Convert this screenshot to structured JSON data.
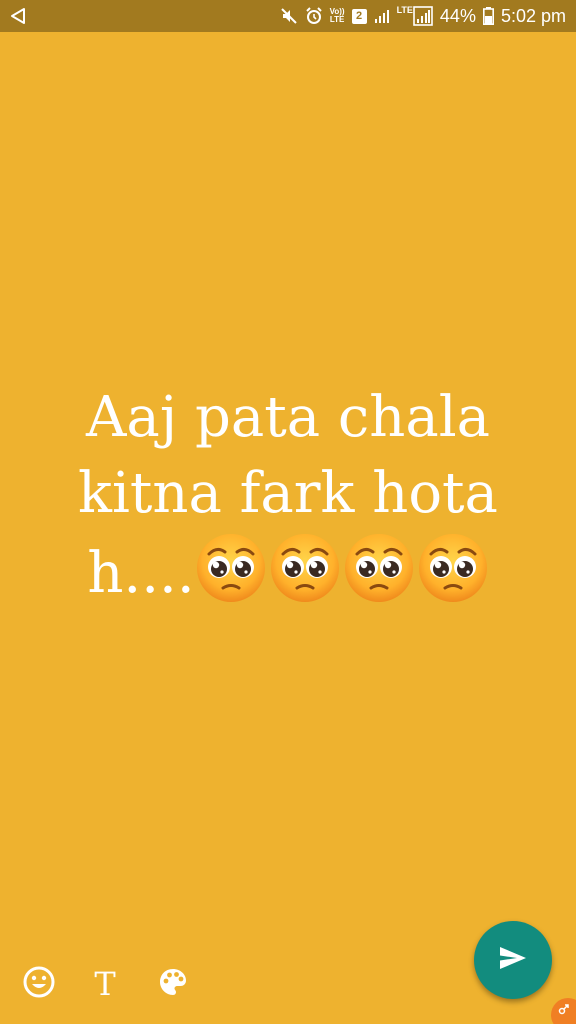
{
  "status_bar": {
    "battery_percent": "44%",
    "time": "5:02 pm",
    "volte_label": "Vo))",
    "lte_small_label": "LTE",
    "sim_number": "2",
    "lte_label": "LTE",
    "icons": [
      "back-icon",
      "mute-icon",
      "alarm-icon",
      "volte-icon",
      "sim-icon",
      "signal-icon",
      "lte-signal-icon",
      "battery-icon"
    ]
  },
  "status_text": {
    "lines": [
      "Aaj pata chala",
      "kitna fark hota",
      "h...."
    ],
    "emoji": "pleading-face",
    "emoji_count": 4
  },
  "toolbar": {
    "text_tool_label": "T",
    "icons": [
      "emoji-icon",
      "text-icon",
      "palette-icon"
    ]
  },
  "send_button": {
    "icon": "send-icon"
  },
  "colors": {
    "background": "#EEB22F",
    "status_bar": "#A27A1F",
    "fab": "#128C7E",
    "text": "#FFFFFF",
    "corner_badge": "#F07F24"
  }
}
